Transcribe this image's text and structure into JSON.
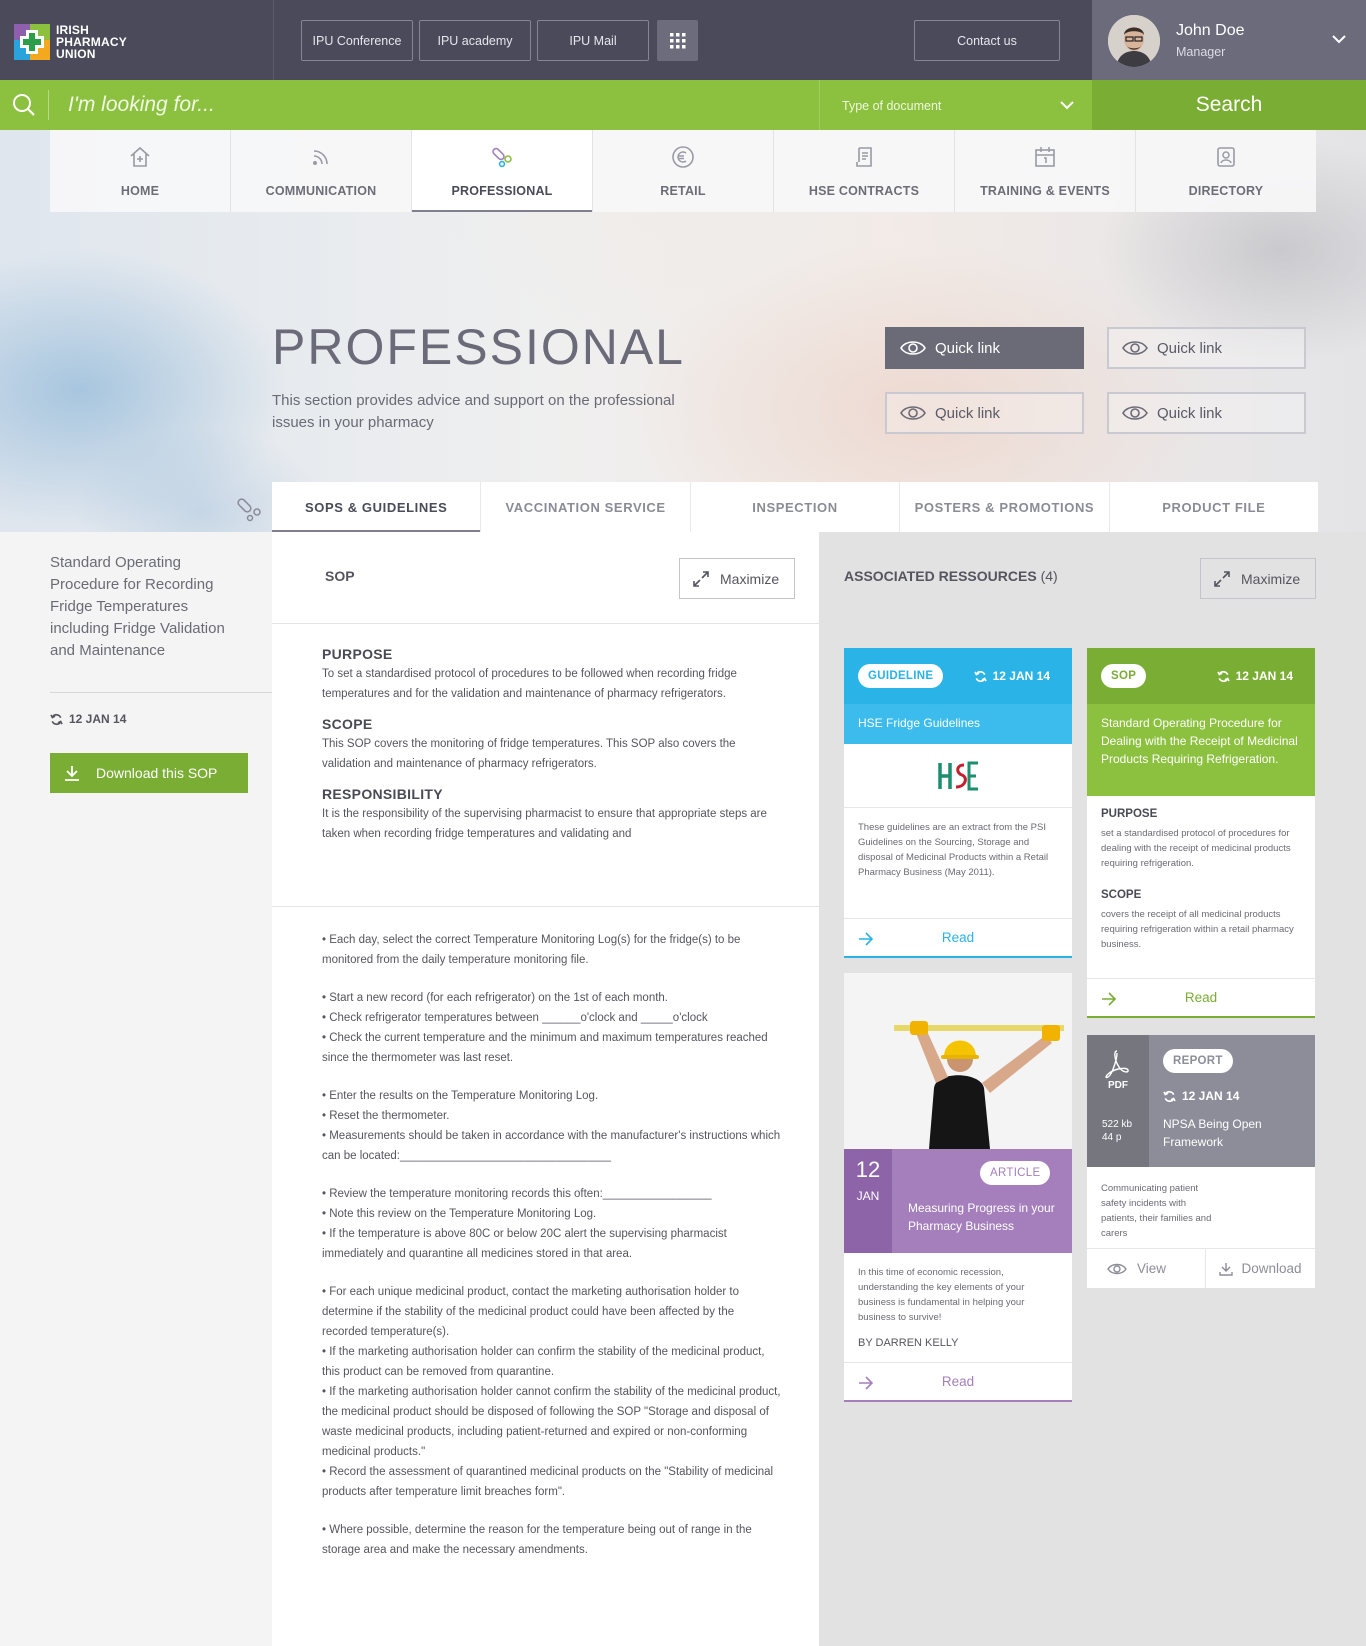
{
  "brand": {
    "line1": "IRISH",
    "line2": "PHARMACY",
    "line3": "UNION"
  },
  "topnav": {
    "conference": "IPU Conference",
    "academy": "IPU academy",
    "mail": "IPU Mail",
    "contact": "Contact us"
  },
  "user": {
    "name": "John Doe",
    "role": "Manager"
  },
  "search": {
    "placeholder": "I'm looking for...",
    "doc_type": "Type of document",
    "button": "Search"
  },
  "nav": {
    "items": [
      {
        "label": "HOME",
        "icon": "home-icon"
      },
      {
        "label": "COMMUNICATION",
        "icon": "broadcast-icon"
      },
      {
        "label": "PROFESSIONAL",
        "icon": "pill-icon",
        "active": true
      },
      {
        "label": "RETAIL",
        "icon": "euro-icon"
      },
      {
        "label": "HSE CONTRACTS",
        "icon": "contract-icon"
      },
      {
        "label": "TRAINING & EVENTS",
        "icon": "calendar-icon"
      },
      {
        "label": "DIRECTORY",
        "icon": "directory-icon"
      }
    ]
  },
  "hero": {
    "title": "PROFESSIONAL",
    "description": "This section provides advice and support on the professional issues in your pharmacy",
    "quick_links": [
      "Quick link",
      "Quick link",
      "Quick link",
      "Quick link"
    ]
  },
  "subtabs": [
    "SOPS & GUIDELINES",
    "VACCINATION SERVICE",
    "INSPECTION",
    "POSTERS & PROMOTIONS",
    "PRODUCT FILE"
  ],
  "sidebar": {
    "sop_title": "Standard Operating Procedure for Recording Fridge Temperatures including Fridge Validation and Maintenance",
    "date": "12 JAN 14",
    "download": "Download this SOP"
  },
  "sop": {
    "heading": "SOP",
    "maximize": "Maximize",
    "purpose_h": "PURPOSE",
    "purpose": "To set a standardised protocol of procedures to be followed when recording fridge temperatures and for the validation and maintenance of pharmacy refrigerators.",
    "scope_h": "SCOPE",
    "scope": "This SOP covers the monitoring of fridge temperatures. This SOP also covers the validation and maintenance of pharmacy refrigerators.",
    "resp_h": "RESPONSIBILITY",
    "resp": "It is the responsibility of the supervising pharmacist to ensure that appropriate steps are taken when recording fridge temperatures and validating and",
    "steps": [
      "•   Each day, select the correct Temperature Monitoring Log(s) for the fridge(s) to be monitored from the daily temperature monitoring file.",
      "•   Start a new record (for each refrigerator) on the 1st of each month.",
      "•   Check refrigerator temperatures between ______o'clock and _____o'clock",
      "•   Check the current temperature and the minimum and maximum temperatures reached since the thermometer was last reset.",
      "•   Enter the results on the Temperature Monitoring Log.",
      "•   Reset the thermometer.",
      "•   Measurements should be taken in accordance with the manufacturer's instructions which can be located:_________________________________",
      "•   Review the temperature monitoring records this often:_________________",
      "•   Note this review on the Temperature Monitoring Log.",
      "•   If the temperature is above 80C or below 20C alert the supervising pharmacist immediately and quarantine all medicines stored in that area.",
      "•   For each unique medicinal product, contact the marketing authorisation holder to determine if the stability of the medicinal product could have been affected by the recorded temperature(s).",
      "•   If the marketing authorisation holder can confirm the stability of the medicinal product, this product can be removed from quarantine.",
      "•   If the marketing authorisation holder cannot confirm the stability of the medicinal product, the medicinal product should be disposed of following the SOP \"Storage and disposal of waste medicinal products, including patient-returned and expired or non-conforming medicinal products.\"",
      "•   Record the assessment of quarantined medicinal products on the \"Stability of medicinal products after temperature limit breaches form\".",
      "•   Where possible, determine the reason for the temperature being out of range in the storage area and make the necessary amendments."
    ]
  },
  "resources": {
    "title": "ASSOCIATED RESSOURCES",
    "count": "(4)",
    "maximize": "Maximize",
    "guideline": {
      "tag": "GUIDELINE",
      "date": "12 JAN 14",
      "title": "HSE Fridge Guidelines",
      "logo_text": "HSE",
      "body": "These guidelines are an extract from the PSI Guidelines on the Sourcing, Storage and disposal of Medicinal Products within a Retail Pharmacy Business (May 2011).",
      "read": "Read",
      "color": "#29b3e6"
    },
    "sop_card": {
      "tag": "SOP",
      "date": "12 JAN 14",
      "title": "Standard Operating Procedure for Dealing with the Receipt of Medicinal Products Requiring Refrigeration.",
      "purpose_h": "PURPOSE",
      "purpose": "set a standardised protocol of procedures for dealing with the receipt of medicinal products requiring refrigeration.",
      "scope_h": "SCOPE",
      "scope": "covers the receipt of all medicinal products requiring refrigeration within a retail pharmacy business.",
      "read": "Read",
      "color": "#7aad33"
    },
    "article": {
      "day": "12",
      "month": "JAN",
      "tag": "ARTICLE",
      "title": "Measuring Progress in your Pharmacy Business",
      "body": "In this time of economic recession, understanding the key elements of your business is fundamental in helping your business to survive!",
      "author": "BY DARREN KELLY",
      "read": "Read",
      "color": "#a47fbc"
    },
    "report": {
      "filetype": "PDF",
      "size": "522 kb",
      "pages": "44 p",
      "tag": "REPORT",
      "date": "12 JAN 14",
      "title": "NPSA Being Open Framework",
      "body": "Communicating patient safety incidents with patients, their families and carers",
      "view": "View",
      "download": "Download",
      "color": "#8d8d99"
    }
  }
}
